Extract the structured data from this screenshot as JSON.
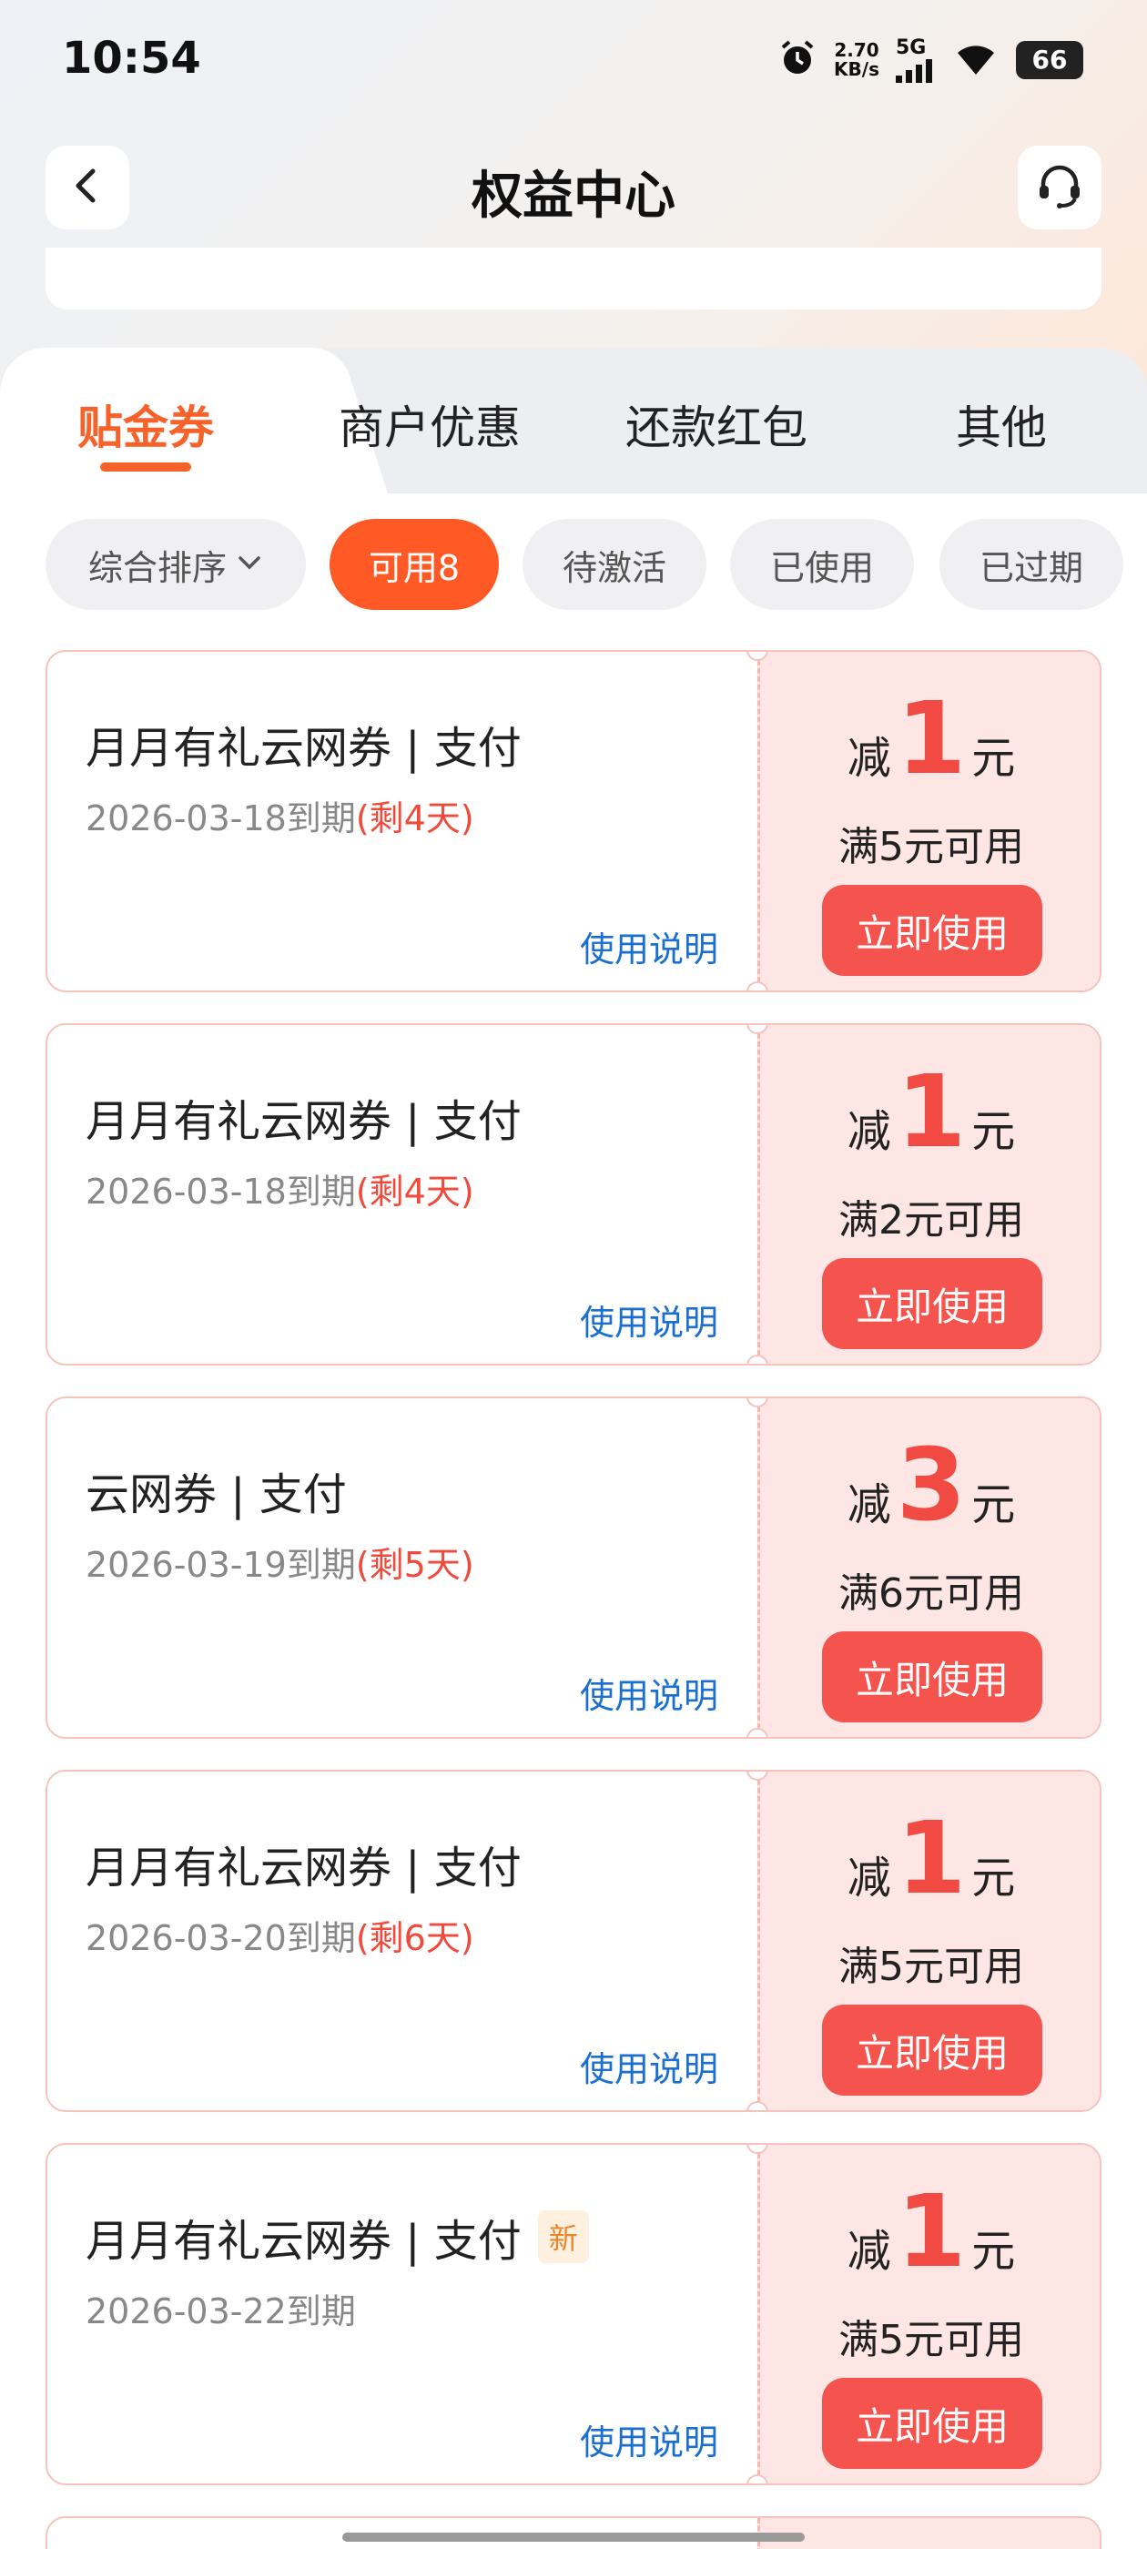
{
  "status_bar": {
    "time": "10:54",
    "net_speed_value": "2.70",
    "net_speed_unit": "KB/s",
    "network": "5G",
    "battery": "66"
  },
  "header": {
    "title": "权益中心",
    "back_icon": "chevron-left-icon",
    "service_icon": "headset-icon"
  },
  "tabs": [
    {
      "label": "贴金券",
      "active": true
    },
    {
      "label": "商户优惠",
      "active": false
    },
    {
      "label": "还款红包",
      "active": false
    },
    {
      "label": "其他",
      "active": false
    }
  ],
  "filters": {
    "sort_label": "综合排序",
    "items": [
      {
        "label": "可用8",
        "active": true
      },
      {
        "label": "待激活",
        "active": false
      },
      {
        "label": "已使用",
        "active": false
      },
      {
        "label": "已过期",
        "active": false
      }
    ]
  },
  "coupon_labels": {
    "reduce_prefix": "减",
    "currency": "元",
    "help": "使用说明",
    "use_button": "立即使用"
  },
  "coupons": [
    {
      "title": "月月有礼云网券 | 支付",
      "date": "2026-03-18到期",
      "remain": "(剩4天)",
      "amount": "1",
      "condition": "满5元可用",
      "badge": ""
    },
    {
      "title": "月月有礼云网券 | 支付",
      "date": "2026-03-18到期",
      "remain": "(剩4天)",
      "amount": "1",
      "condition": "满2元可用",
      "badge": ""
    },
    {
      "title": "云网券 | 支付",
      "date": "2026-03-19到期",
      "remain": "(剩5天)",
      "amount": "3",
      "condition": "满6元可用",
      "badge": ""
    },
    {
      "title": "月月有礼云网券 | 支付",
      "date": "2026-03-20到期",
      "remain": "(剩6天)",
      "amount": "1",
      "condition": "满5元可用",
      "badge": ""
    },
    {
      "title": "月月有礼云网券 | 支付",
      "date": "2026-03-22到期",
      "remain": "",
      "amount": "1",
      "condition": "满5元可用",
      "badge": "新"
    }
  ],
  "colors": {
    "accent": "#f6622a",
    "filter_active": "#ff5a26",
    "use_button": "#f4534e",
    "amount": "#f14a42",
    "help_link": "#1a6fd0"
  }
}
